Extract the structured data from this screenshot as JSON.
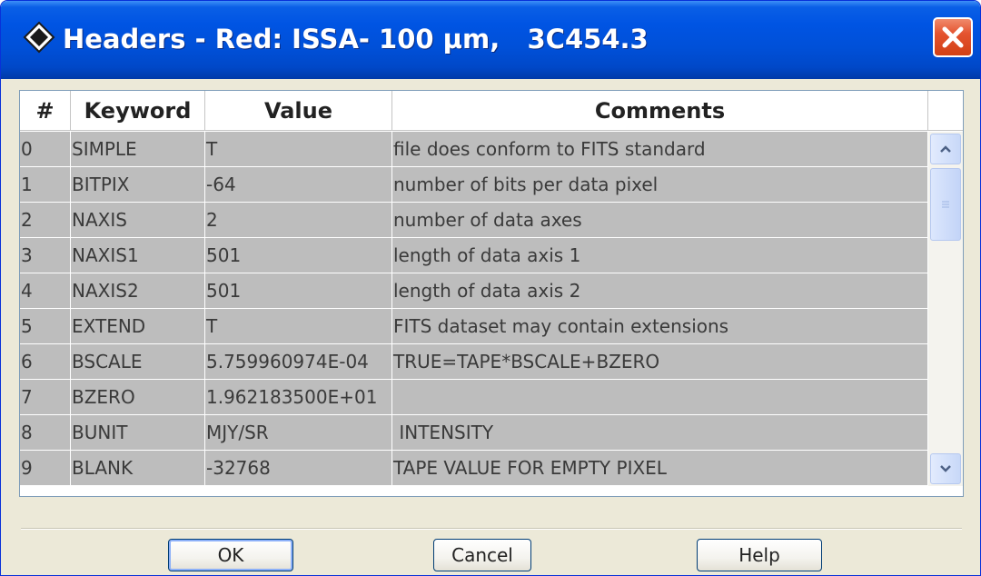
{
  "window": {
    "title": "Headers - Red: ISSA- 100 µm,   3C454.3",
    "icon": "diamond-app-icon",
    "close_icon": "close-x-icon"
  },
  "table": {
    "columns": [
      "#",
      "Keyword",
      "Value",
      "Comments"
    ],
    "rows": [
      {
        "num": "0",
        "keyword": "SIMPLE",
        "value": "T",
        "comment": "file does conform to FITS standard"
      },
      {
        "num": "1",
        "keyword": "BITPIX",
        "value": "-64",
        "comment": "number of bits per data pixel"
      },
      {
        "num": "2",
        "keyword": "NAXIS",
        "value": "2",
        "comment": "number of data axes"
      },
      {
        "num": "3",
        "keyword": "NAXIS1",
        "value": "501",
        "comment": "length of data axis 1"
      },
      {
        "num": "4",
        "keyword": "NAXIS2",
        "value": "501",
        "comment": "length of data axis 2"
      },
      {
        "num": "5",
        "keyword": "EXTEND",
        "value": "T",
        "comment": "FITS dataset may contain extensions"
      },
      {
        "num": "6",
        "keyword": "BSCALE",
        "value": "5.759960974E-04",
        "comment": "TRUE=TAPE*BSCALE+BZERO"
      },
      {
        "num": "7",
        "keyword": "BZERO",
        "value": "1.962183500E+01",
        "comment": ""
      },
      {
        "num": "8",
        "keyword": "BUNIT",
        "value": "MJY/SR",
        "comment": " INTENSITY"
      },
      {
        "num": "9",
        "keyword": "BLANK",
        "value": "-32768",
        "comment": "TAPE VALUE FOR EMPTY PIXEL"
      }
    ]
  },
  "scrollbar": {
    "up_icon": "chevron-up-icon",
    "down_icon": "chevron-down-icon",
    "grip_icon": "grip-lines-icon"
  },
  "buttons": {
    "ok": "OK",
    "cancel": "Cancel",
    "help": "Help"
  },
  "colors": {
    "titlebar": "#0054e3",
    "window_bg": "#ece9d8",
    "row_bg": "#bdbdbd",
    "close_btn": "#e4532f"
  }
}
